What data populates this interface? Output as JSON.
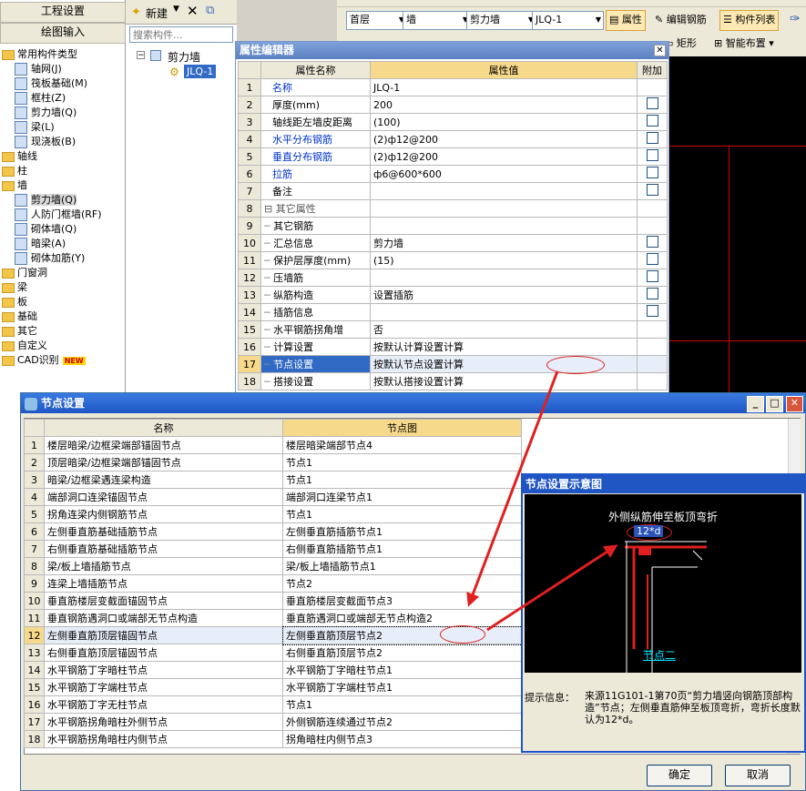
{
  "left_nav": {
    "btn1": "工程设置",
    "btn2": "绘图输入",
    "tree": [
      {
        "label": "常用构件类型",
        "type": "folder",
        "indent": 0
      },
      {
        "label": "轴网(J)",
        "type": "item",
        "indent": 1
      },
      {
        "label": "筏板基础(M)",
        "type": "item",
        "indent": 1
      },
      {
        "label": "框柱(Z)",
        "type": "item",
        "indent": 1
      },
      {
        "label": "剪力墙(Q)",
        "type": "item",
        "indent": 1
      },
      {
        "label": "梁(L)",
        "type": "item",
        "indent": 1
      },
      {
        "label": "现浇板(B)",
        "type": "item",
        "indent": 1
      },
      {
        "label": "轴线",
        "type": "folder",
        "indent": 0
      },
      {
        "label": "柱",
        "type": "folder",
        "indent": 0
      },
      {
        "label": "墙",
        "type": "folder",
        "indent": 0
      },
      {
        "label": "剪力墙(Q)",
        "type": "item",
        "indent": 1
      },
      {
        "label": "人防门框墙(RF)",
        "type": "item",
        "indent": 1
      },
      {
        "label": "砌体墙(Q)",
        "type": "item",
        "indent": 1
      },
      {
        "label": "暗梁(A)",
        "type": "item",
        "indent": 1
      },
      {
        "label": "砌体加筋(Y)",
        "type": "item",
        "indent": 1
      },
      {
        "label": "门窗洞",
        "type": "folder",
        "indent": 0
      },
      {
        "label": "梁",
        "type": "folder",
        "indent": 0
      },
      {
        "label": "板",
        "type": "folder",
        "indent": 0
      },
      {
        "label": "基础",
        "type": "folder",
        "indent": 0
      },
      {
        "label": "其它",
        "type": "folder",
        "indent": 0
      },
      {
        "label": "自定义",
        "type": "folder",
        "indent": 0
      },
      {
        "label": "CAD识别",
        "type": "folder",
        "indent": 0
      }
    ],
    "new_badge": "NEW"
  },
  "mid_tree": {
    "new_label": "新建",
    "search_placeholder": "搜索构件...",
    "root": "剪力墙",
    "child": "JLQ-1"
  },
  "toolbar": {
    "floor": "首层",
    "category": "墙",
    "type": "剪力墙",
    "component": "JLQ-1",
    "btn_property": "属性",
    "btn_edit_rebar": "编辑钢筋",
    "btn_list": "构件列表",
    "btn_rect": "矩形",
    "btn_smart": "智能布置"
  },
  "prop_editor": {
    "title": "属性编辑器",
    "headers": [
      "属性名称",
      "属性值",
      "附加"
    ],
    "rows": [
      {
        "n": "1",
        "name": "名称",
        "value": "JLQ-1",
        "blue": true,
        "chk": false
      },
      {
        "n": "2",
        "name": "厚度(mm)",
        "value": "200",
        "blue": false,
        "chk": true
      },
      {
        "n": "3",
        "name": "轴线距左墙皮距离",
        "value": "(100)",
        "blue": false,
        "chk": true
      },
      {
        "n": "4",
        "name": "水平分布钢筋",
        "value": "(2)ф12@200",
        "blue": true,
        "chk": true
      },
      {
        "n": "5",
        "name": "垂直分布钢筋",
        "value": "(2)ф12@200",
        "blue": true,
        "chk": true
      },
      {
        "n": "6",
        "name": "拉筋",
        "value": "ф6@600*600",
        "blue": true,
        "chk": true
      },
      {
        "n": "7",
        "name": "备注",
        "value": "",
        "blue": false,
        "chk": true
      },
      {
        "n": "8",
        "name": "其它属性",
        "value": "",
        "blue": false,
        "chk": false,
        "group": true
      },
      {
        "n": "9",
        "name": "其它钢筋",
        "value": "",
        "blue": false,
        "chk": false,
        "sub": true
      },
      {
        "n": "10",
        "name": "汇总信息",
        "value": "剪力墙",
        "blue": false,
        "chk": true,
        "sub": true
      },
      {
        "n": "11",
        "name": "保护层厚度(mm)",
        "value": "(15)",
        "blue": false,
        "chk": true,
        "sub": true
      },
      {
        "n": "12",
        "name": "压墙筋",
        "value": "",
        "blue": false,
        "chk": true,
        "sub": true
      },
      {
        "n": "13",
        "name": "纵筋构造",
        "value": "设置插筋",
        "blue": false,
        "chk": true,
        "sub": true
      },
      {
        "n": "14",
        "name": "插筋信息",
        "value": "",
        "blue": false,
        "chk": true,
        "sub": true
      },
      {
        "n": "15",
        "name": "水平钢筋拐角增",
        "value": "否",
        "blue": false,
        "chk": false,
        "sub": true
      },
      {
        "n": "16",
        "name": "计算设置",
        "value": "按默认计算设置计算",
        "blue": false,
        "chk": false,
        "sub": true
      },
      {
        "n": "17",
        "name": "节点设置",
        "value": "按默认节点设置计算",
        "blue": false,
        "chk": false,
        "sub": true,
        "selected": true
      },
      {
        "n": "18",
        "name": "搭接设置",
        "value": "按默认搭接设置计算",
        "blue": false,
        "chk": false,
        "sub": true
      }
    ]
  },
  "node_dialog": {
    "title": "节点设置",
    "headers": [
      "名称",
      "节点图"
    ],
    "rows": [
      {
        "n": "1",
        "name": "楼层暗梁/边框梁端部锚固节点",
        "node": "楼层暗梁端部节点4"
      },
      {
        "n": "2",
        "name": "顶层暗梁/边框梁端部锚固节点",
        "node": "节点1"
      },
      {
        "n": "3",
        "name": "暗梁/边框梁遇连梁构造",
        "node": "节点1"
      },
      {
        "n": "4",
        "name": "端部洞口连梁锚固节点",
        "node": "端部洞口连梁节点1"
      },
      {
        "n": "5",
        "name": "拐角连梁内侧钢筋节点",
        "node": "节点1"
      },
      {
        "n": "6",
        "name": "左侧垂直筋基础插筋节点",
        "node": "左侧垂直筋插筋节点1"
      },
      {
        "n": "7",
        "name": "右侧垂直筋基础插筋节点",
        "node": "右侧垂直筋插筋节点1"
      },
      {
        "n": "8",
        "name": "梁/板上墙插筋节点",
        "node": "梁/板上墙插筋节点1"
      },
      {
        "n": "9",
        "name": "连梁上墙插筋节点",
        "node": "节点2"
      },
      {
        "n": "10",
        "name": "垂直筋楼层变截面锚固节点",
        "node": "垂直筋楼层变截面节点3"
      },
      {
        "n": "11",
        "name": "垂直钢筋遇洞口或端部无节点构造",
        "node": "垂直筋遇洞口或端部无节点构造2"
      },
      {
        "n": "12",
        "name": "左侧垂直筋顶层锚固节点",
        "node": "左侧垂直筋顶层节点2",
        "selected": true
      },
      {
        "n": "13",
        "name": "右侧垂直筋顶层锚固节点",
        "node": "右侧垂直筋顶层节点2"
      },
      {
        "n": "14",
        "name": "水平钢筋丁字暗柱节点",
        "node": "水平钢筋丁字暗柱节点1"
      },
      {
        "n": "15",
        "name": "水平钢筋丁字端柱节点",
        "node": "水平钢筋丁字端柱节点1"
      },
      {
        "n": "16",
        "name": "水平钢筋丁字无柱节点",
        "node": "节点1"
      },
      {
        "n": "17",
        "name": "水平钢筋拐角暗柱外侧节点",
        "node": "外侧钢筋连续通过节点2"
      },
      {
        "n": "18",
        "name": "水平钢筋拐角暗柱内侧节点",
        "node": "拐角暗柱内侧节点3"
      }
    ],
    "ok": "确定",
    "cancel": "取消"
  },
  "diagram": {
    "title": "节点设置示意图",
    "caption": "外侧纵筋伸至板顶弯折",
    "dim_label": "12*d",
    "node_name": "节点二",
    "hint_label": "提示信息：",
    "hint_text": "来源11G101-1第70页“剪力墙竖向钢筋顶部构造”节点；左侧垂直筋伸至板顶弯折，弯折长度默认为12*d。"
  }
}
